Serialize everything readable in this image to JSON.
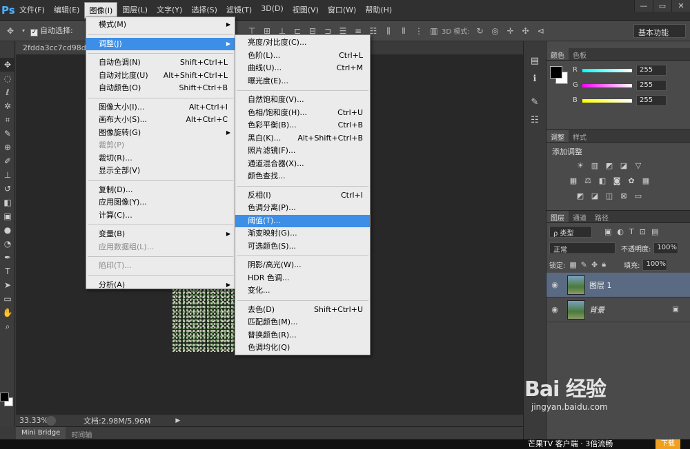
{
  "app": {
    "logo": "Ps"
  },
  "menubar": {
    "items": [
      "文件(F)",
      "编辑(E)",
      "图像(I)",
      "图层(L)",
      "文字(Y)",
      "选择(S)",
      "滤镜(T)",
      "3D(D)",
      "视图(V)",
      "窗口(W)",
      "帮助(H)"
    ],
    "active_index": 2
  },
  "window_controls": {
    "minimize": "—",
    "restore": "▭",
    "close": "✕"
  },
  "options_bar": {
    "auto_select_label": "自动选择:",
    "mode_3d_label": "3D 模式:",
    "workspace": "基本功能"
  },
  "document": {
    "tab_title": "2fdda3cc7cd98d1"
  },
  "status": {
    "zoom": "33.33%",
    "doc_size": "文档:2.98M/5.96M"
  },
  "bottom_tabs": [
    "Mini Bridge",
    "时间轴"
  ],
  "promo": {
    "text": "芒果TV  客户端 · 3倍流畅",
    "button": "下载"
  },
  "color_panel": {
    "tabs": [
      "颜色",
      "色板"
    ],
    "sliders": [
      {
        "label": "R",
        "value": "255",
        "gradient": "linear-gradient(to right,#0ff,#fff)"
      },
      {
        "label": "G",
        "value": "255",
        "gradient": "linear-gradient(to right,#f0f,#fff)"
      },
      {
        "label": "B",
        "value": "255",
        "gradient": "linear-gradient(to right,#ff0,#fff)"
      }
    ]
  },
  "adjust_panel": {
    "tabs": [
      "调整",
      "样式"
    ],
    "title": "添加调整"
  },
  "layers_panel": {
    "tabs": [
      "图层",
      "通道",
      "路径"
    ],
    "kind_filter": "ρ 类型",
    "blend_mode": "正常",
    "opacity_label": "不透明度:",
    "opacity": "100%",
    "lock_label": "锁定:",
    "fill_label": "填充:",
    "fill": "100%",
    "layers": [
      {
        "name": "图层 1",
        "selected": true,
        "locked": false
      },
      {
        "name": "背景",
        "selected": false,
        "locked": true
      }
    ]
  },
  "image_menu": {
    "items": [
      {
        "label": "模式(M)",
        "shortcut": "",
        "submenu": true
      },
      {
        "sep": true
      },
      {
        "label": "调整(J)",
        "shortcut": "",
        "submenu": true,
        "highlighted": true
      },
      {
        "sep": true
      },
      {
        "label": "自动色调(N)",
        "shortcut": "Shift+Ctrl+L"
      },
      {
        "label": "自动对比度(U)",
        "shortcut": "Alt+Shift+Ctrl+L"
      },
      {
        "label": "自动颜色(O)",
        "shortcut": "Shift+Ctrl+B"
      },
      {
        "sep": true
      },
      {
        "label": "图像大小(I)...",
        "shortcut": "Alt+Ctrl+I"
      },
      {
        "label": "画布大小(S)...",
        "shortcut": "Alt+Ctrl+C"
      },
      {
        "label": "图像旋转(G)",
        "shortcut": "",
        "submenu": true
      },
      {
        "label": "裁剪(P)",
        "shortcut": "",
        "disabled": true
      },
      {
        "label": "裁切(R)...",
        "shortcut": ""
      },
      {
        "label": "显示全部(V)",
        "shortcut": ""
      },
      {
        "sep": true
      },
      {
        "label": "复制(D)...",
        "shortcut": ""
      },
      {
        "label": "应用图像(Y)...",
        "shortcut": ""
      },
      {
        "label": "计算(C)...",
        "shortcut": ""
      },
      {
        "sep": true
      },
      {
        "label": "变量(B)",
        "shortcut": "",
        "submenu": true
      },
      {
        "label": "应用数据组(L)...",
        "shortcut": "",
        "disabled": true
      },
      {
        "sep": true
      },
      {
        "label": "陷印(T)...",
        "shortcut": "",
        "disabled": true
      },
      {
        "sep": true
      },
      {
        "label": "分析(A)",
        "shortcut": "",
        "submenu": true
      }
    ]
  },
  "adjust_menu": {
    "items": [
      {
        "label": "亮度/对比度(C)...",
        "shortcut": ""
      },
      {
        "label": "色阶(L)...",
        "shortcut": "Ctrl+L"
      },
      {
        "label": "曲线(U)...",
        "shortcut": "Ctrl+M"
      },
      {
        "label": "曝光度(E)...",
        "shortcut": ""
      },
      {
        "sep": true
      },
      {
        "label": "自然饱和度(V)...",
        "shortcut": ""
      },
      {
        "label": "色相/饱和度(H)...",
        "shortcut": "Ctrl+U"
      },
      {
        "label": "色彩平衡(B)...",
        "shortcut": "Ctrl+B"
      },
      {
        "label": "黑白(K)...",
        "shortcut": "Alt+Shift+Ctrl+B"
      },
      {
        "label": "照片滤镜(F)...",
        "shortcut": ""
      },
      {
        "label": "通道混合器(X)...",
        "shortcut": ""
      },
      {
        "label": "颜色查找...",
        "shortcut": ""
      },
      {
        "sep": true
      },
      {
        "label": "反相(I)",
        "shortcut": "Ctrl+I"
      },
      {
        "label": "色调分离(P)...",
        "shortcut": ""
      },
      {
        "label": "阈值(T)...",
        "shortcut": "",
        "highlighted": true
      },
      {
        "label": "渐变映射(G)...",
        "shortcut": ""
      },
      {
        "label": "可选颜色(S)...",
        "shortcut": ""
      },
      {
        "sep": true
      },
      {
        "label": "阴影/高光(W)...",
        "shortcut": ""
      },
      {
        "label": "HDR 色调...",
        "shortcut": ""
      },
      {
        "label": "变化...",
        "shortcut": ""
      },
      {
        "sep": true
      },
      {
        "label": "去色(D)",
        "shortcut": "Shift+Ctrl+U"
      },
      {
        "label": "匹配颜色(M)...",
        "shortcut": ""
      },
      {
        "label": "替换颜色(R)...",
        "shortcut": ""
      },
      {
        "label": "色调均化(Q)",
        "shortcut": ""
      }
    ]
  },
  "watermark": {
    "logo": "Bai 经验",
    "url": "jingyan.baidu.com"
  }
}
